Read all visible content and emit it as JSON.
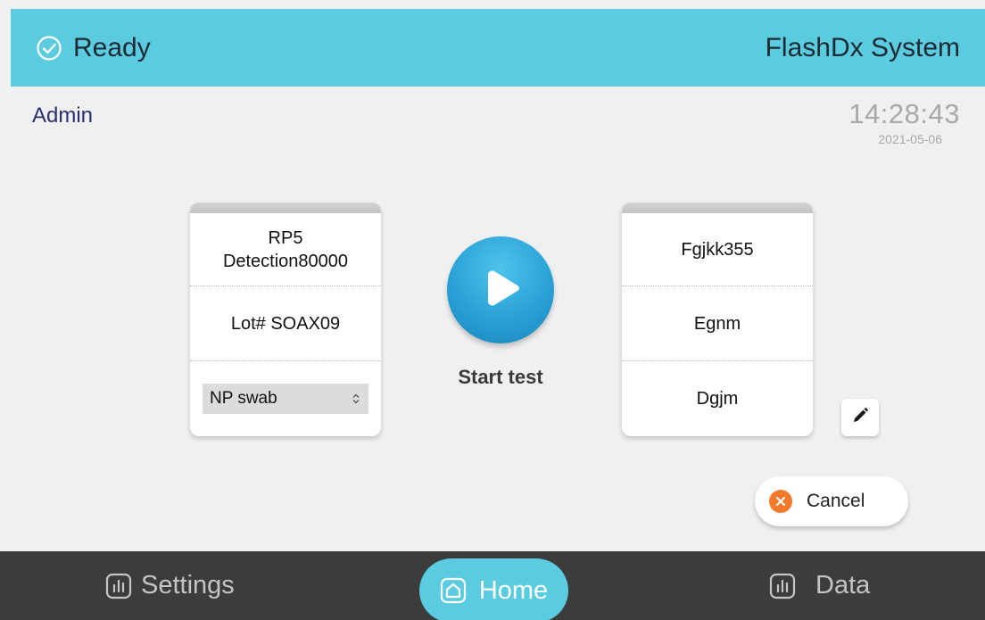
{
  "header": {
    "status_text": "Ready",
    "system_title": "FlashDx System"
  },
  "user": {
    "name": "Admin"
  },
  "clock": {
    "time": "14:28:43",
    "date": "2021-05-06"
  },
  "assay_card": {
    "assay_name": "RP5\nDetection80000",
    "lot": "Lot# SOAX09",
    "sample_type": "NP swab"
  },
  "start": {
    "label": "Start test"
  },
  "sample_card": {
    "field1": "Fgjkk355",
    "field2": "Egnm",
    "field3": "Dgjm"
  },
  "cancel": {
    "label": "Cancel"
  },
  "nav": {
    "settings_label": "Settings",
    "home_label": "Home",
    "data_label": "Data"
  },
  "colors": {
    "accent": "#5bcbe0",
    "nav_bg": "#3c3c3c",
    "cancel": "#f27a2a",
    "start": "#2aa1d6"
  }
}
